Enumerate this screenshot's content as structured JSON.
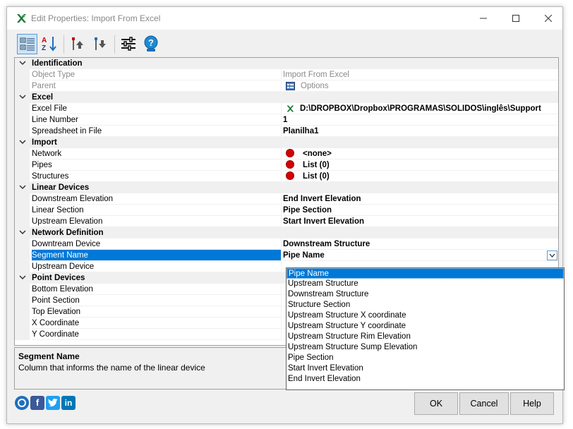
{
  "window": {
    "title": "Edit Properties: Import From Excel"
  },
  "toolbar": {
    "buttons": [
      "categorized-view",
      "alphabetical-sort",
      "move-up",
      "move-down",
      "settings",
      "help"
    ]
  },
  "grid": {
    "rows": [
      {
        "type": "category",
        "label": "Identification"
      },
      {
        "type": "prop",
        "name": "Object Type",
        "value": "Import From Excel",
        "readonly": true
      },
      {
        "type": "prop",
        "name": "Parent",
        "value": "Options",
        "readonly": true,
        "icon": "options-icon"
      },
      {
        "type": "category",
        "label": "Excel"
      },
      {
        "type": "prop",
        "name": "Excel File",
        "value": "D:\\DROPBOX\\Dropbox\\PROGRAMAS\\SOLIDOS\\inglês\\Support",
        "icon": "excel-icon"
      },
      {
        "type": "prop",
        "name": "Line Number",
        "value": "1"
      },
      {
        "type": "prop",
        "name": "Spreadsheet in File",
        "value": "Planilha1"
      },
      {
        "type": "category",
        "label": "Import"
      },
      {
        "type": "prop",
        "name": "Network",
        "value": "<none>",
        "icon": "red-dot"
      },
      {
        "type": "prop",
        "name": "Pipes",
        "value": "List (0)",
        "icon": "red-dot"
      },
      {
        "type": "prop",
        "name": "Structures",
        "value": "List (0)",
        "icon": "red-dot"
      },
      {
        "type": "category",
        "label": "Linear Devices"
      },
      {
        "type": "prop",
        "name": "Downstream Elevation",
        "value": "End Invert Elevation"
      },
      {
        "type": "prop",
        "name": "Linear Section",
        "value": "Pipe Section"
      },
      {
        "type": "prop",
        "name": "Upstream Elevation",
        "value": "Start Invert Elevation"
      },
      {
        "type": "category",
        "label": "Network Definition"
      },
      {
        "type": "prop",
        "name": "Downtream Device",
        "value": "Downstream Structure"
      },
      {
        "type": "prop",
        "name": "Segment Name",
        "value": "Pipe Name",
        "selected": true
      },
      {
        "type": "prop",
        "name": "Upstream Device",
        "value": ""
      },
      {
        "type": "category",
        "label": "Point Devices"
      },
      {
        "type": "prop",
        "name": "Bottom Elevation",
        "value": ""
      },
      {
        "type": "prop",
        "name": "Point Section",
        "value": ""
      },
      {
        "type": "prop",
        "name": "Top Elevation",
        "value": ""
      },
      {
        "type": "prop",
        "name": "X Coordinate",
        "value": ""
      },
      {
        "type": "prop",
        "name": "Y Coordinate",
        "value": ""
      }
    ]
  },
  "dropdown": {
    "selected": "Pipe Name",
    "options": [
      "Pipe Name",
      "Upstream Structure",
      "Downstream Structure",
      "Structure Section",
      "Upstream Structure X coordinate",
      "Upstream Structure Y coordinate",
      "Upstream Structure Rim Elevation",
      "Upstream Structure Sump Elevation",
      "Pipe Section",
      "Start Invert Elevation",
      "End Invert Elevation"
    ]
  },
  "description": {
    "title": "Segment Name",
    "text": "Column that informs the name of the linear device"
  },
  "social": [
    "help-circle",
    "facebook",
    "twitter",
    "linkedin"
  ],
  "buttons": {
    "ok": "OK",
    "cancel": "Cancel",
    "help": "Help"
  },
  "colors": {
    "selection": "#0078d7",
    "status_red": "#d40000",
    "excel_green": "#1d7a3a"
  }
}
